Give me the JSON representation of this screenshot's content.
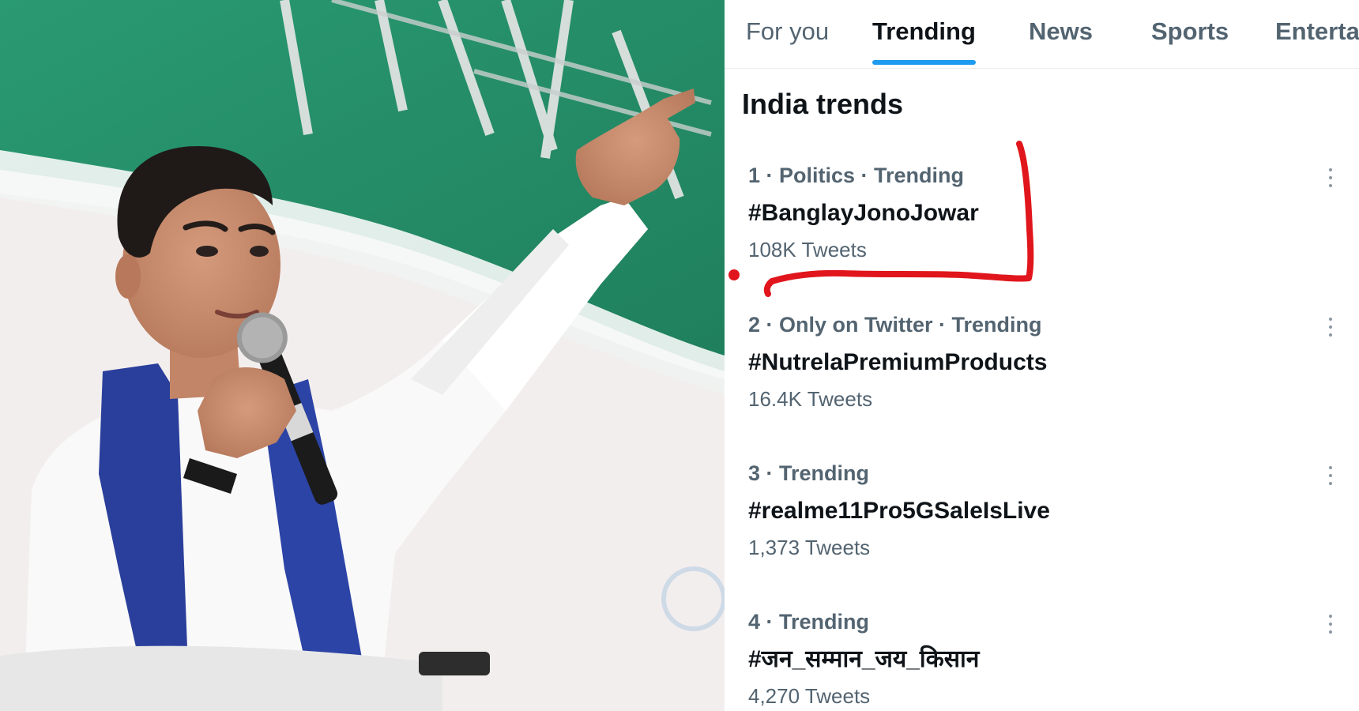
{
  "tabs": [
    {
      "label": "For you",
      "active": false
    },
    {
      "label": "Trending",
      "active": true
    },
    {
      "label": "News",
      "active": false
    },
    {
      "label": "Sports",
      "active": false
    },
    {
      "label": "Enterta",
      "active": false
    }
  ],
  "section_title": "India trends",
  "trends": [
    {
      "meta": "1 · Politics · Trending",
      "name": "#BanglayJonoJowar",
      "count": "108K Tweets"
    },
    {
      "meta": "2 · Only on Twitter · Trending",
      "name": "#NutrelaPremiumProducts",
      "count": "16.4K Tweets"
    },
    {
      "meta": "3 · Trending",
      "name": "#realme11Pro5GSaleIsLive",
      "count": "1,373 Tweets"
    },
    {
      "meta": "4 · Trending",
      "name": "#जन_सम्मान_जय_किसान",
      "count": "4,270 Tweets"
    }
  ],
  "colors": {
    "accent": "#1d9bf0",
    "text_primary": "#0f1419",
    "text_secondary": "#536471",
    "annotation_red": "#e0161c"
  },
  "icons": {
    "more": "more-options-icon"
  }
}
